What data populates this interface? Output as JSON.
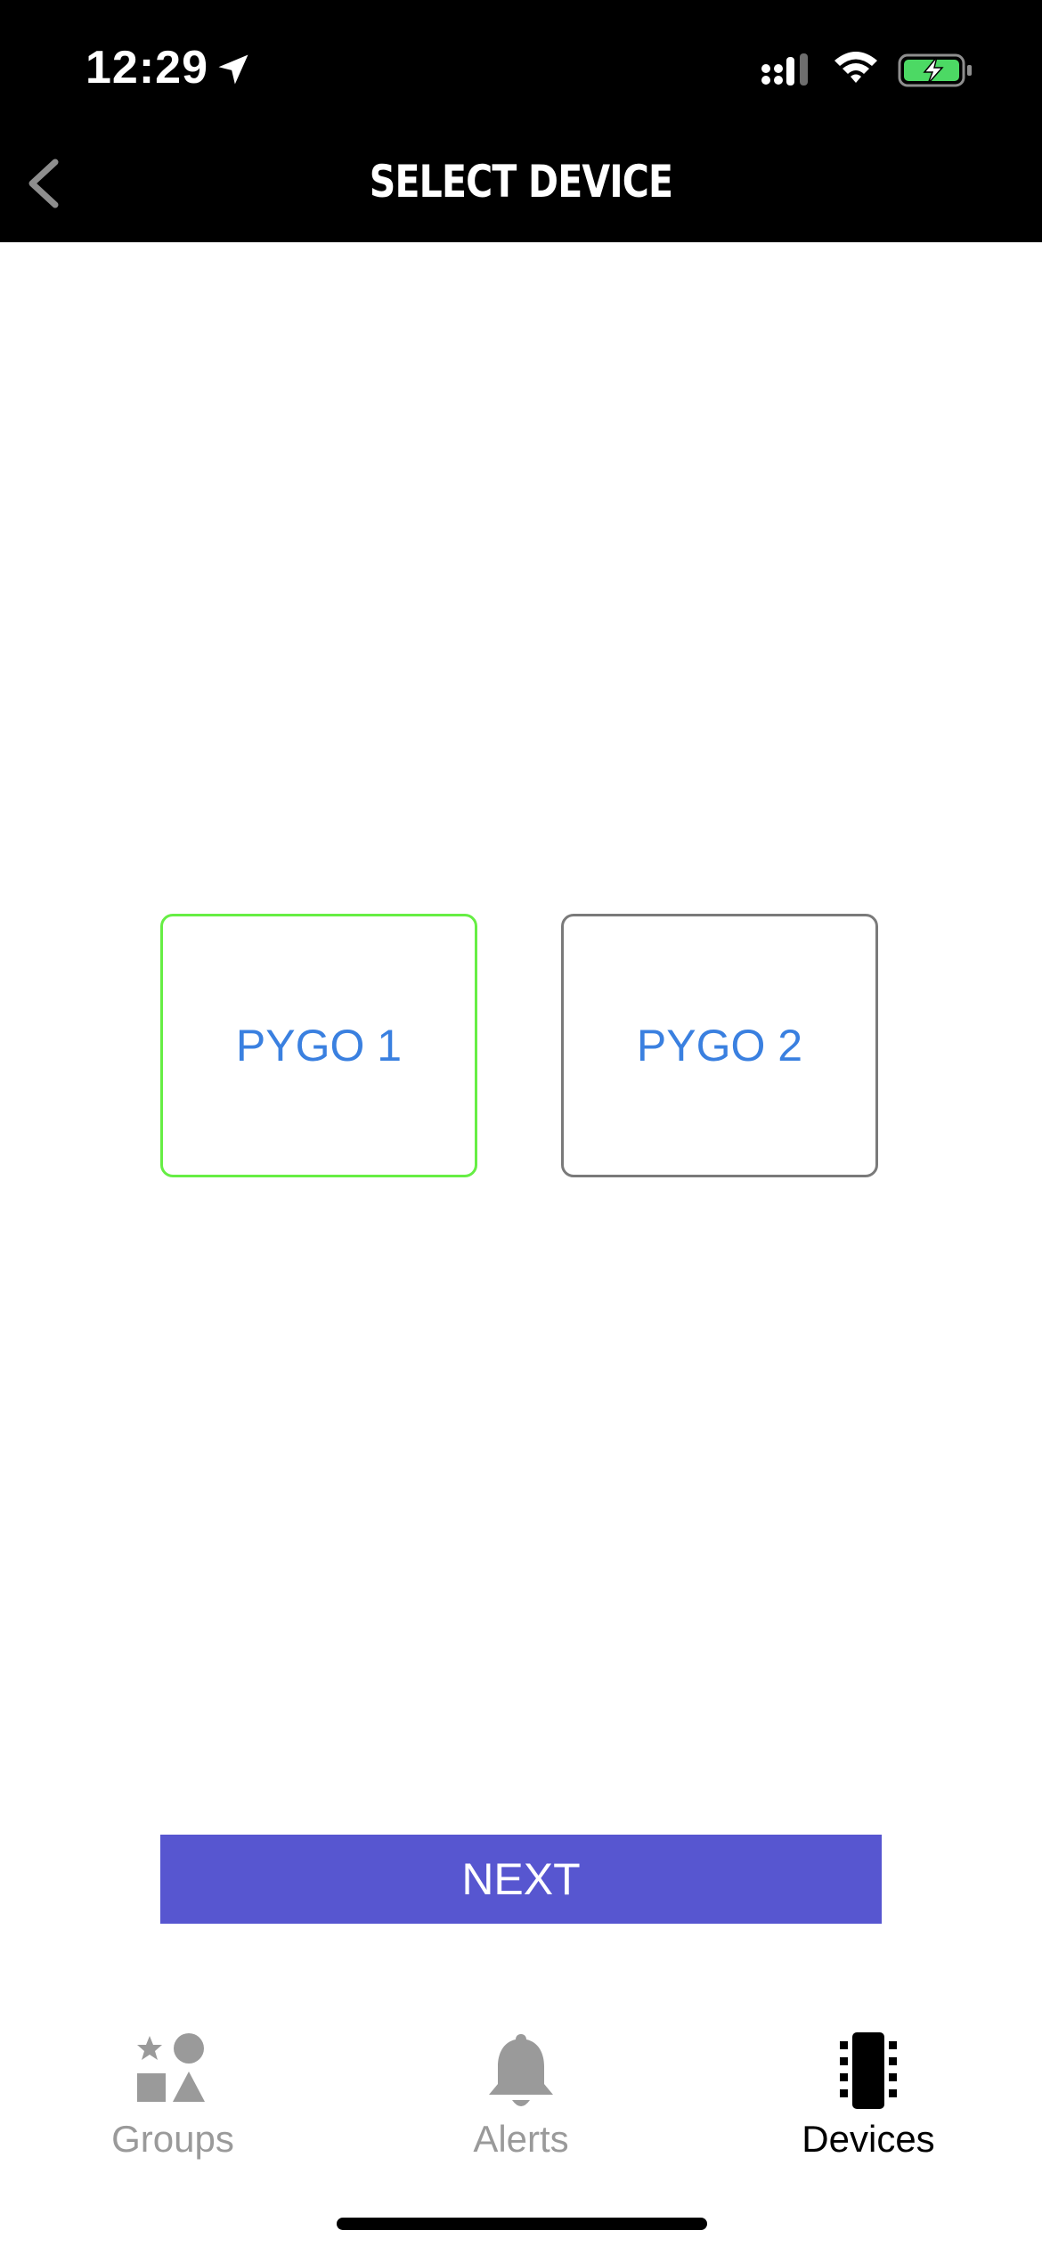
{
  "status_bar": {
    "time": "12:29",
    "location_icon": "location-arrow-icon",
    "signal_icon": "cellular-signal-icon",
    "wifi_icon": "wifi-icon",
    "battery_icon": "battery-charging-icon",
    "battery_color": "#4cd964"
  },
  "header": {
    "back_icon": "chevron-left-icon",
    "title": "SELECT DEVICE"
  },
  "devices": {
    "items": [
      {
        "label": "PYGO 1",
        "selected": true,
        "border_color": "#66ee44"
      },
      {
        "label": "PYGO 2",
        "selected": false,
        "border_color": "#7a7a7a"
      }
    ],
    "label_color": "#3a80e0"
  },
  "next_button": {
    "label": "NEXT",
    "color": "#5756d0"
  },
  "tab_bar": {
    "tabs": [
      {
        "label": "Groups",
        "icon": "shapes-icon",
        "active": false
      },
      {
        "label": "Alerts",
        "icon": "bell-icon",
        "active": false
      },
      {
        "label": "Devices",
        "icon": "chip-icon",
        "active": true
      }
    ],
    "active_color": "#000000",
    "inactive_color": "#9a9a9a"
  }
}
